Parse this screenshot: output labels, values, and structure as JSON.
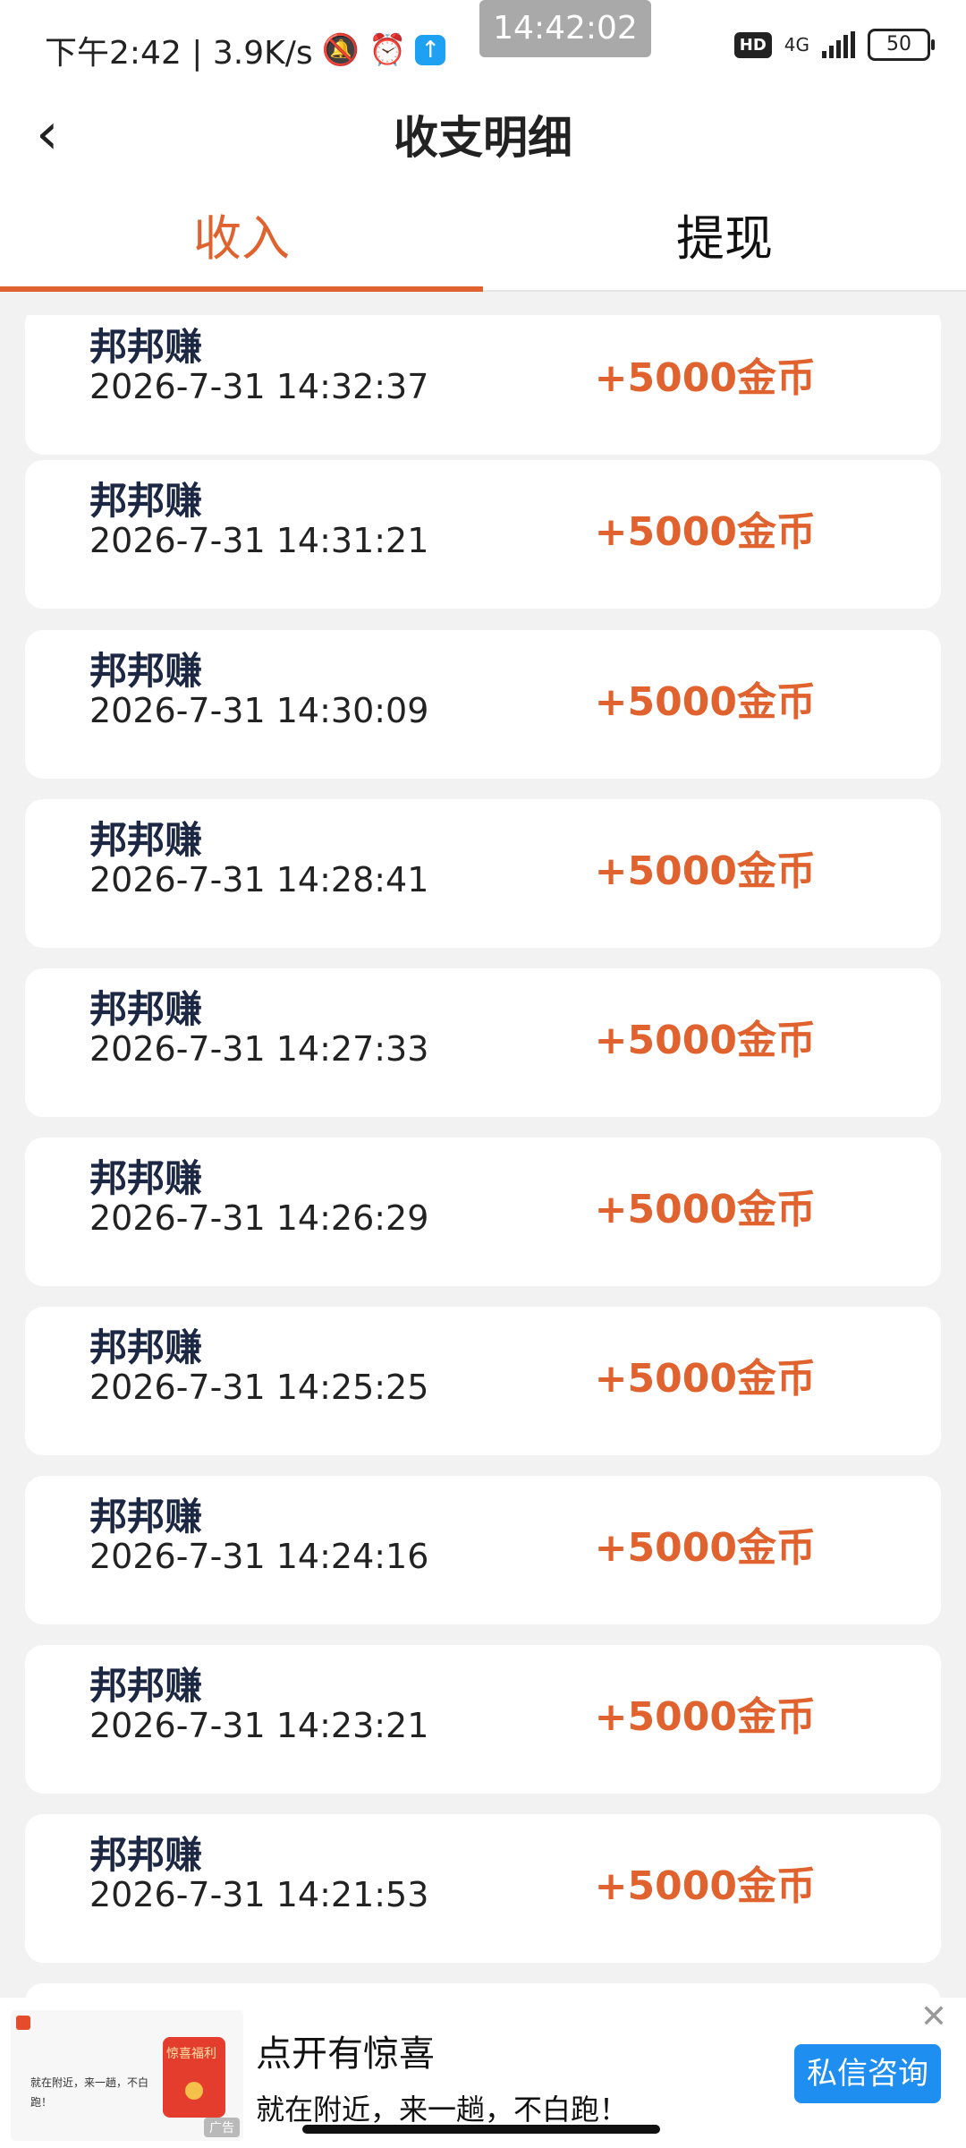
{
  "status_bar": {
    "left_text": "下午2:42 | 3.9K/s",
    "clock_pill": "14:42:02",
    "hd": "HD",
    "network": "4G",
    "battery": "50"
  },
  "header": {
    "title": "收支明细"
  },
  "tabs": [
    {
      "label": "收入",
      "active": true
    },
    {
      "label": "提现",
      "active": false
    }
  ],
  "records": [
    {
      "name": "邦邦赚",
      "time": "2026-7-31 14:32:37",
      "amount": "+5000金币"
    },
    {
      "name": "邦邦赚",
      "time": "2026-7-31 14:31:21",
      "amount": "+5000金币"
    },
    {
      "name": "邦邦赚",
      "time": "2026-7-31 14:30:09",
      "amount": "+5000金币"
    },
    {
      "name": "邦邦赚",
      "time": "2026-7-31 14:28:41",
      "amount": "+5000金币"
    },
    {
      "name": "邦邦赚",
      "time": "2026-7-31 14:27:33",
      "amount": "+5000金币"
    },
    {
      "name": "邦邦赚",
      "time": "2026-7-31 14:26:29",
      "amount": "+5000金币"
    },
    {
      "name": "邦邦赚",
      "time": "2026-7-31 14:25:25",
      "amount": "+5000金币"
    },
    {
      "name": "邦邦赚",
      "time": "2026-7-31 14:24:16",
      "amount": "+5000金币"
    },
    {
      "name": "邦邦赚",
      "time": "2026-7-31 14:23:21",
      "amount": "+5000金币"
    },
    {
      "name": "邦邦赚",
      "time": "2026-7-31 14:21:53",
      "amount": "+5000金币"
    }
  ],
  "ad": {
    "thumb_text": "就在附近，来一趟，不白跑！",
    "thumb_badge": "惊喜福利",
    "tag": "广告",
    "title": "点开有惊喜",
    "subtitle": "就在附近，来一趟，不白跑！",
    "button": "私信咨询"
  },
  "colors": {
    "accent": "#e0622e",
    "ad_button": "#1e8ef0",
    "name_text": "#1c2744"
  }
}
